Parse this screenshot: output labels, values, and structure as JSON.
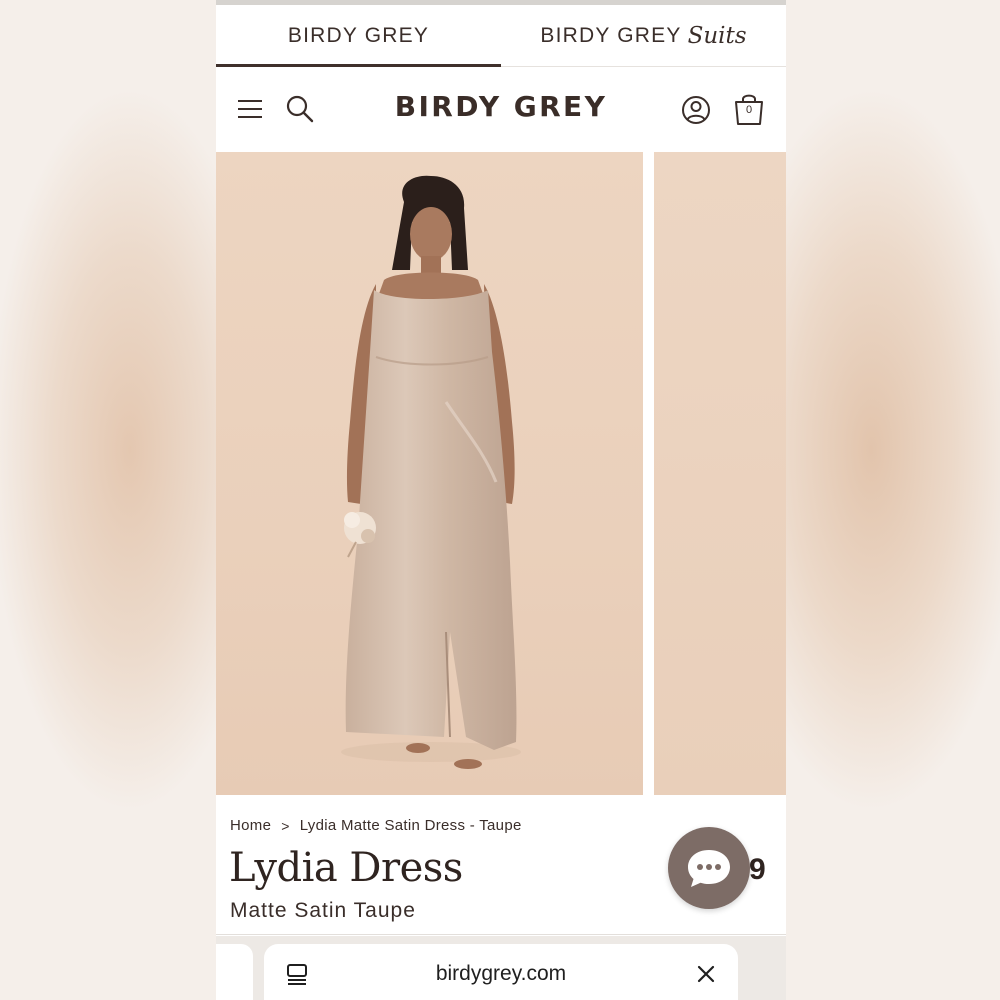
{
  "brand_tabs": [
    {
      "label": "BIRDY GREY",
      "suffix": "",
      "active": true
    },
    {
      "label": "BIRDY GREY",
      "suffix": "Suits",
      "active": false
    }
  ],
  "header": {
    "logo": "BIRDY GREY",
    "cart_count": "0",
    "icons": [
      "menu-icon",
      "search-icon",
      "account-icon",
      "shopping-bag-icon"
    ]
  },
  "breadcrumb": {
    "home": "Home",
    "separator": ">",
    "current": "Lydia Matte Satin Dress - Taupe"
  },
  "product": {
    "title": "Lydia Dress",
    "subtitle": "Matte Satin Taupe",
    "price_fragment": "9"
  },
  "browser": {
    "url": "birdygrey.com"
  },
  "colors": {
    "brand_dark": "#3a2d28",
    "chat_button": "#7d6c66",
    "backdrop": "#ead0bb"
  }
}
